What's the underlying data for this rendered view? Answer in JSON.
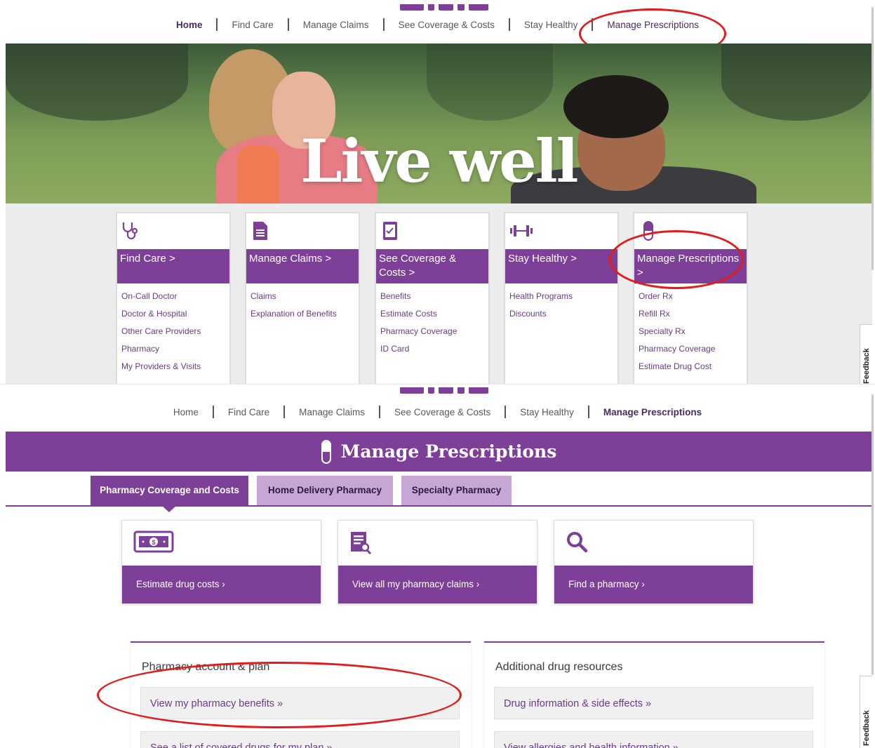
{
  "nav": {
    "items": [
      "Home",
      "Find Care",
      "Manage Claims",
      "See Coverage & Costs",
      "Stay Healthy",
      "Manage Prescriptions"
    ]
  },
  "hero": {
    "title": "Live well"
  },
  "categories": [
    {
      "label": "Find Care >",
      "icon": "stethoscope-icon",
      "links": [
        "On-Call Doctor",
        "Doctor & Hospital",
        "Other Care Providers",
        "Pharmacy",
        "My Providers & Visits"
      ]
    },
    {
      "label": "Manage Claims >",
      "icon": "document-icon",
      "links": [
        "Claims",
        "Explanation of Benefits"
      ]
    },
    {
      "label": "See Coverage & Costs >",
      "icon": "clipboard-check-icon",
      "links": [
        "Benefits",
        "Estimate Costs",
        "Pharmacy Coverage",
        "ID Card"
      ]
    },
    {
      "label": "Stay Healthy >",
      "icon": "dumbbell-icon",
      "links": [
        "Health Programs",
        "Discounts"
      ]
    },
    {
      "label": "Manage Prescriptions >",
      "icon": "pill-icon",
      "links": [
        "Order Rx",
        "Refill Rx",
        "Specialty Rx",
        "Pharmacy Coverage",
        "Estimate Drug Cost"
      ]
    }
  ],
  "feedback_label": "Feedback",
  "prescriptions_page": {
    "banner_title": "Manage Prescriptions",
    "tabs": [
      "Pharmacy Coverage and Costs",
      "Home Delivery Pharmacy",
      "Specialty Pharmacy"
    ],
    "actions": [
      {
        "label": "Estimate drug costs  ›",
        "icon": "money-icon"
      },
      {
        "label": "View all my pharmacy claims  ›",
        "icon": "claims-document-icon"
      },
      {
        "label": "Find a pharmacy  ›",
        "icon": "search-icon"
      }
    ],
    "panels": [
      {
        "title": "Pharmacy account & plan",
        "links": [
          "View my pharmacy benefits »",
          "See a list of covered drugs for my plan »"
        ]
      },
      {
        "title": "Additional drug resources",
        "links": [
          "Drug information & side effects »",
          "View allergies and health information »"
        ]
      }
    ]
  },
  "colors": {
    "brand_purple": "#7d3f98",
    "tab_inactive": "#c6a6d4",
    "annotation_red": "#e21b1b"
  }
}
